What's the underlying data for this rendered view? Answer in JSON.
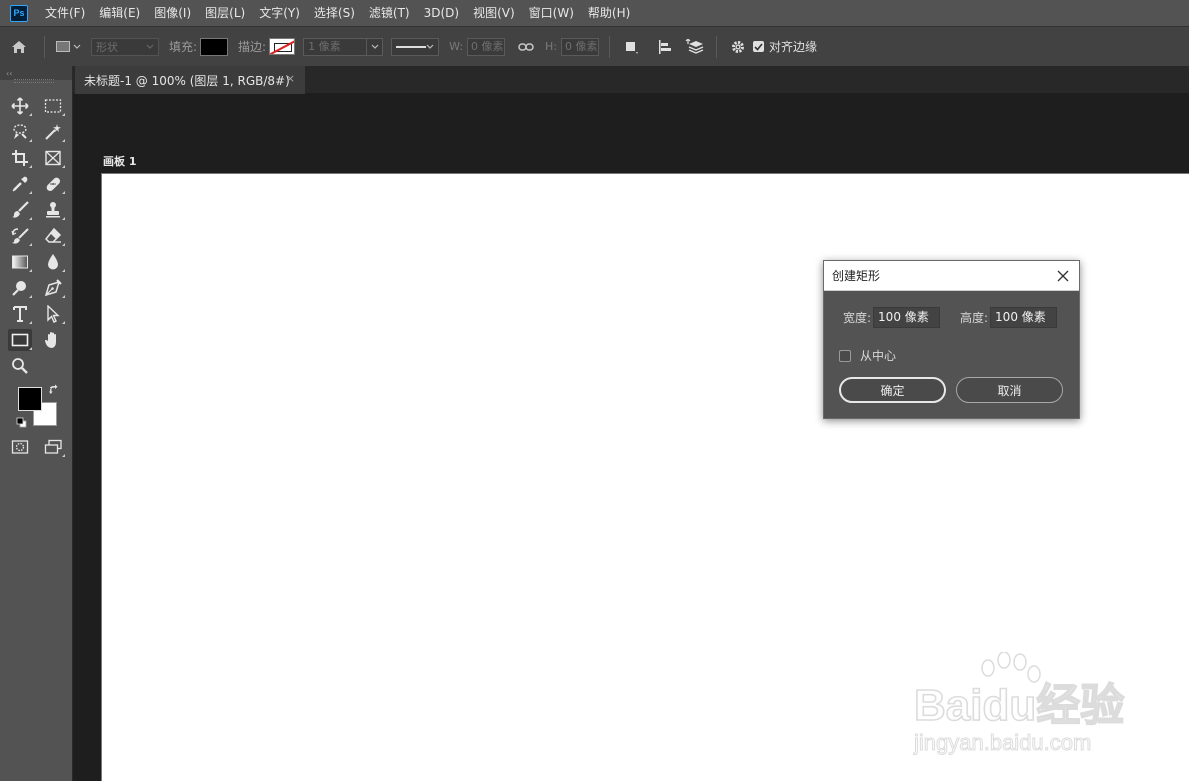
{
  "app": {
    "logo_text": "Ps"
  },
  "menu": [
    "文件(F)",
    "编辑(E)",
    "图像(I)",
    "图层(L)",
    "文字(Y)",
    "选择(S)",
    "滤镜(T)",
    "3D(D)",
    "视图(V)",
    "窗口(W)",
    "帮助(H)"
  ],
  "options": {
    "mode": "形状",
    "fill_label": "填充:",
    "stroke_label": "描边:",
    "stroke_width": "1 像素",
    "w_label": "W:",
    "w_value": "0 像素",
    "h_label": "H:",
    "h_value": "0 像素",
    "align_edges_label": "对齐边缘",
    "align_edges_checked": true
  },
  "tools": {
    "collapse_label": "‹‹"
  },
  "document": {
    "tab_title": "未标题-1 @ 100% (图层 1, RGB/8#)",
    "tab_close": "×",
    "artboard_label": "画板 1"
  },
  "dialog": {
    "title": "创建矩形",
    "width_label": "宽度:",
    "width_value": "100 像素",
    "height_label": "高度:",
    "height_value": "100 像素",
    "from_center_label": "从中心",
    "from_center_checked": false,
    "ok_label": "确定",
    "cancel_label": "取消"
  },
  "watermark": {
    "brand": "Baidu经验",
    "url": "jingyan.baidu.com"
  },
  "colors": {
    "foreground": "#000000",
    "background": "#ffffff",
    "accent": "#31a8ff"
  }
}
